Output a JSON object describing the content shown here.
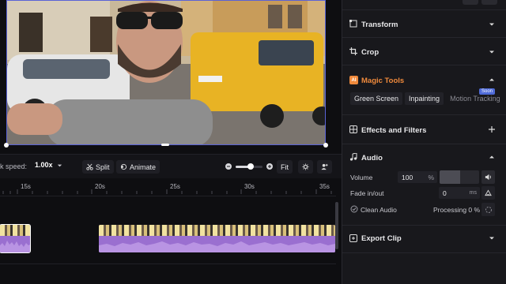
{
  "toolbar": {
    "speed_label": "k speed:",
    "speed_value": "1.00x",
    "split_label": "Split",
    "animate_label": "Animate",
    "fit_label": "Fit",
    "zoom_level": 0.55
  },
  "timeline": {
    "ticks": [
      "15s",
      "20s",
      "25s",
      "30s",
      "35s"
    ]
  },
  "panel": {
    "transform_title": "Transform",
    "crop_title": "Crop",
    "magic_tools_title": "Magic Tools",
    "magic_tabs": [
      "Green Screen",
      "Inpainting",
      "Motion Tracking"
    ],
    "soon_badge": "Soon",
    "effects_title": "Effects and Filters",
    "audio_title": "Audio",
    "volume_label": "Volume",
    "volume_value": "100",
    "volume_unit": "%",
    "fade_label": "Fade in/out",
    "fade_value": "0",
    "fade_unit": "ms",
    "clean_audio_label": "Clean Audio",
    "processing_label": "Processing 0 %",
    "export_title": "Export Clip"
  },
  "colors": {
    "accent": "#5a63d6",
    "clip_purple": "#a67bd6",
    "magic_orange": "#f08a3c"
  }
}
